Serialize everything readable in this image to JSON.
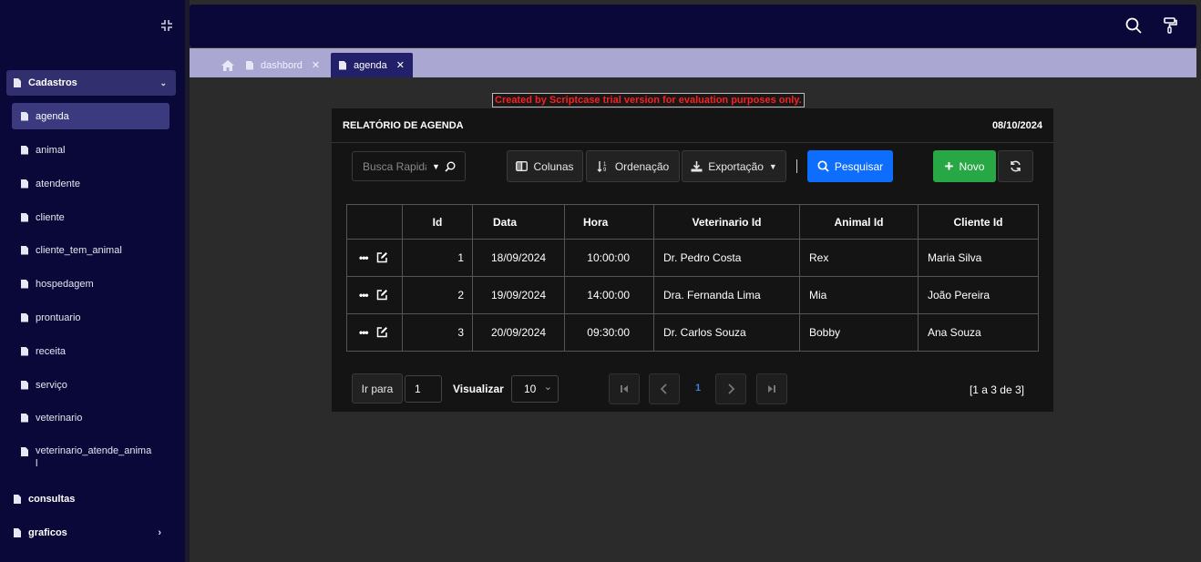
{
  "sidebar": {
    "group": {
      "label": "Cadastros"
    },
    "items": [
      {
        "label": "agenda"
      },
      {
        "label": "animal"
      },
      {
        "label": "atendente"
      },
      {
        "label": "cliente"
      },
      {
        "label": "cliente_tem_animal"
      },
      {
        "label": "hospedagem"
      },
      {
        "label": "prontuario"
      },
      {
        "label": "receita"
      },
      {
        "label": "serviço"
      },
      {
        "label": "veterinario"
      },
      {
        "label": "veterinario_atende_anima\nl"
      }
    ],
    "bottom": [
      {
        "label": "consultas"
      },
      {
        "label": "graficos"
      }
    ]
  },
  "tabs": [
    {
      "label": "dashbord"
    },
    {
      "label": "agenda"
    }
  ],
  "watermark": "Created by Scriptcase trial version for evaluation purposes only.",
  "report": {
    "title": "RELATÓRIO DE AGENDA",
    "date": "08/10/2024"
  },
  "toolbar": {
    "search_placeholder": "Busca Rapida",
    "columns_label": "Colunas",
    "sort_label": "Ordenação",
    "export_label": "Exportação",
    "search_button_label": "Pesquisar",
    "new_label": "Novo"
  },
  "table": {
    "headers": [
      "Id",
      "Data",
      "Hora",
      "Veterinario Id",
      "Animal Id",
      "Cliente Id"
    ],
    "rows": [
      [
        "1",
        "18/09/2024",
        "10:00:00",
        "Dr. Pedro Costa",
        "Rex",
        "Maria Silva"
      ],
      [
        "2",
        "19/09/2024",
        "14:00:00",
        "Dra. Fernanda Lima",
        "Mia",
        "João Pereira"
      ],
      [
        "3",
        "20/09/2024",
        "09:30:00",
        "Dr. Carlos Souza",
        "Bobby",
        "Ana Souza"
      ]
    ]
  },
  "pager": {
    "goto_label": "Ir para",
    "goto_value": "1",
    "view_label": "Visualizar",
    "page_size": "10",
    "current_page": "1",
    "summary": "[1 a 3 de 3]"
  }
}
